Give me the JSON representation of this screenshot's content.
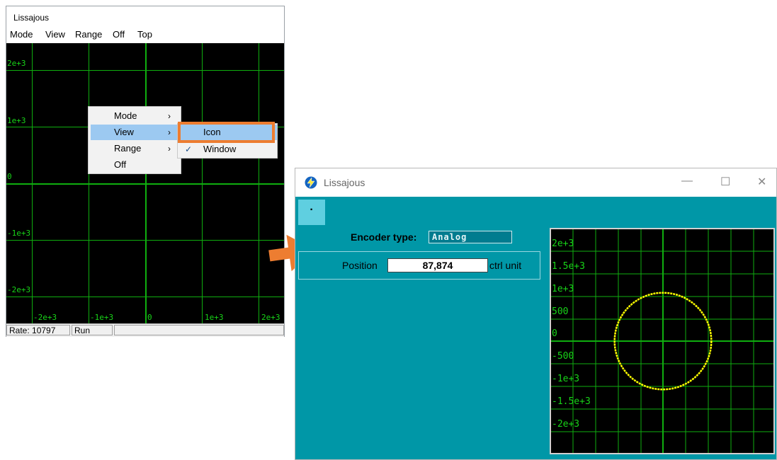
{
  "left_window": {
    "title": "Lissajous",
    "menubar": [
      "Mode",
      "View",
      "Range",
      "Off",
      "Top"
    ],
    "plot": {
      "y_labels": [
        "2e+3",
        "1e+3",
        "0",
        "-1e+3",
        "-2e+3"
      ],
      "x_labels": [
        "-2e+3",
        "-1e+3",
        "0",
        "1e+3",
        "2e+3"
      ],
      "grid_color": "#0fae0f",
      "label_color": "#18d418"
    },
    "status": {
      "rate": "Rate: 10797",
      "state": "Run"
    },
    "context_menu": {
      "items": [
        {
          "label": "Mode",
          "submenu": true
        },
        {
          "label": "View",
          "submenu": true,
          "highlighted": true
        },
        {
          "label": "Range",
          "submenu": true
        },
        {
          "label": "Off",
          "submenu": false
        }
      ],
      "view_submenu": [
        {
          "label": "Icon",
          "highlighted": true
        },
        {
          "label": "Window",
          "checked": true,
          "check_glyph": "✓"
        }
      ],
      "arrow_glyph": "›"
    },
    "highlight_color": "#ed7d31"
  },
  "arrow_color": "#ed7d31",
  "right_window": {
    "title": "Lissajous",
    "icon": "lightning-app-icon",
    "controls": {
      "minimize": "—",
      "maximize": "☐",
      "close": "✕"
    },
    "dot_button": "·",
    "encoder_type_label": "Encoder type:",
    "encoder_type_value": "Analog",
    "position_label": "Position",
    "position_value": "87,874",
    "position_unit": "ctrl unit",
    "background_color": "#0097a7",
    "plot": {
      "y_labels": [
        "2e+3",
        "1.5e+3",
        "1e+3",
        "500",
        "0",
        "-500",
        "-1e+3",
        "-1.5e+3",
        "-2e+3"
      ],
      "trace_color": "#ffff00",
      "trace_shape": "circle",
      "trace_radius": 1000,
      "axis_range": [
        -2500,
        2500
      ]
    }
  }
}
